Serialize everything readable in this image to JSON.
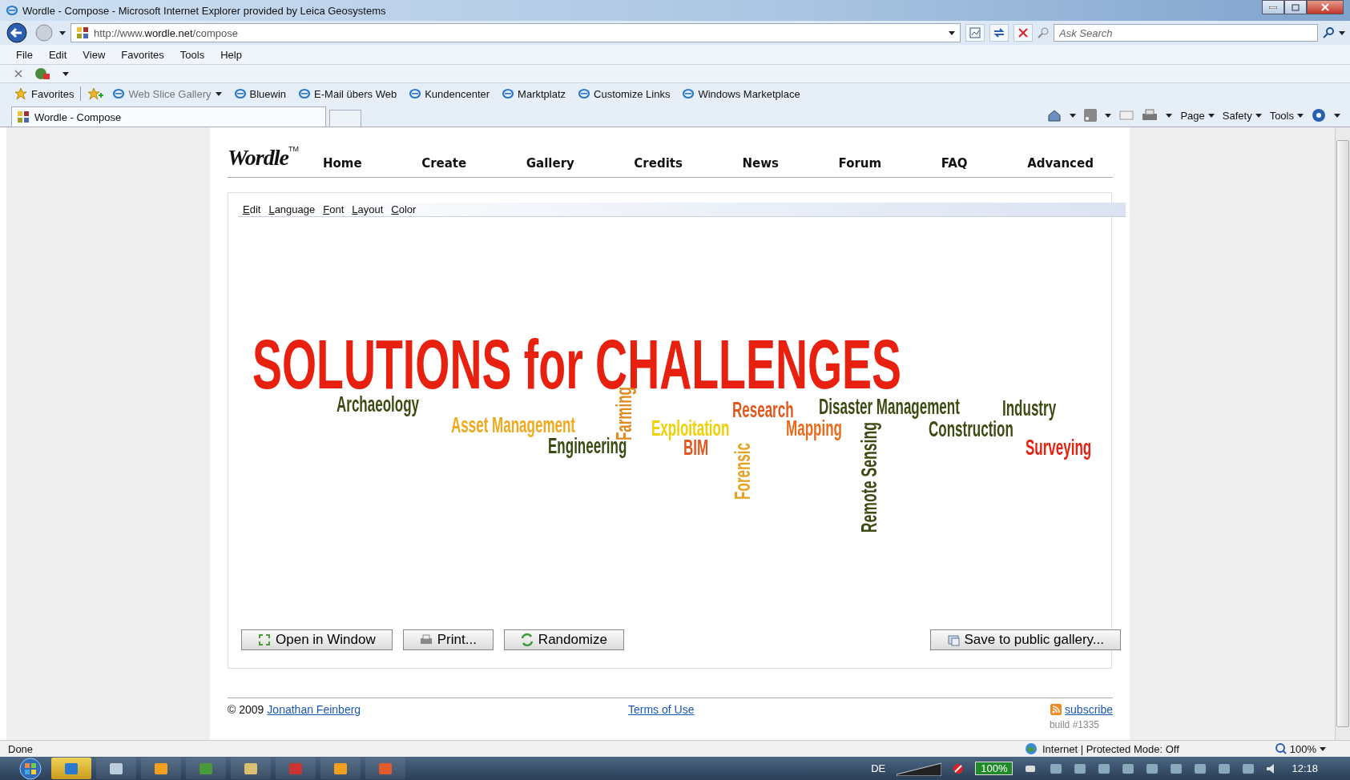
{
  "window": {
    "title": "Wordle - Compose - Microsoft Internet Explorer provided by Leica Geosystems"
  },
  "address_bar": {
    "url": "http://www.**wordle.net**/compose"
  },
  "search": {
    "placeholder": "Ask Search"
  },
  "menu_bar": [
    "File",
    "Edit",
    "View",
    "Favorites",
    "Tools",
    "Help"
  ],
  "favorites_bar": {
    "label": "Favorites",
    "links": [
      {
        "label": "Web Slice Gallery",
        "dropdown": true
      },
      {
        "label": "Bluewin",
        "dropdown": false
      },
      {
        "label": "E-Mail übers Web",
        "dropdown": false
      },
      {
        "label": "Kundencenter",
        "dropdown": false
      },
      {
        "label": "Marktplatz",
        "dropdown": false
      },
      {
        "label": "Customize Links",
        "dropdown": false
      },
      {
        "label": "Windows Marketplace",
        "dropdown": false
      }
    ]
  },
  "tabs": [
    {
      "label": "Wordle - Compose",
      "selected": true
    }
  ],
  "command_bar": [
    "Page",
    "Safety",
    "Tools"
  ],
  "site": {
    "logo": "Wordle",
    "trademark": "TM",
    "nav": [
      "Home",
      "Create",
      "Gallery",
      "Credits",
      "News",
      "Forum",
      "FAQ",
      "Advanced"
    ]
  },
  "editor_menu": [
    "Edit",
    "Language",
    "Font",
    "Layout",
    "Color"
  ],
  "cloud": [
    {
      "text": "SOLUTIONS for CHALLENGES",
      "color": "#e8200f",
      "kind": "horizontal"
    },
    {
      "text": "Archaeology",
      "color": "#3d4a12",
      "kind": "horizontal"
    },
    {
      "text": "Asset Management",
      "color": "#f2a81d",
      "kind": "horizontal"
    },
    {
      "text": "Farming",
      "color": "#e08a1e",
      "kind": "vertical"
    },
    {
      "text": "Engineering",
      "color": "#3a4a10",
      "kind": "horizontal"
    },
    {
      "text": "Exploitation",
      "color": "#f0d000",
      "kind": "horizontal"
    },
    {
      "text": "BIM",
      "color": "#e2571e",
      "kind": "horizontal"
    },
    {
      "text": "Forensic",
      "color": "#e8a020",
      "kind": "vertical"
    },
    {
      "text": "Research",
      "color": "#e2571e",
      "kind": "horizontal"
    },
    {
      "text": "Mapping",
      "color": "#e86a1a",
      "kind": "horizontal"
    },
    {
      "text": "Disaster Management",
      "color": "#3d4a12",
      "kind": "horizontal"
    },
    {
      "text": "Remote Sensing",
      "color": "#3d4a12",
      "kind": "vertical"
    },
    {
      "text": "Industry",
      "color": "#3d4a12",
      "kind": "horizontal"
    },
    {
      "text": "Construction",
      "color": "#3d4a12",
      "kind": "horizontal"
    },
    {
      "text": "Surveying",
      "color": "#e8200f",
      "kind": "horizontal"
    }
  ],
  "buttons": [
    "Open in Window",
    "Print...",
    "Randomize",
    "Save to public gallery..."
  ],
  "footer": {
    "copyright": "© 2009",
    "author_link": "Jonathan Feinberg",
    "terms_link": "Terms of Use",
    "subscribe_link": "subscribe",
    "build": "build #1335"
  },
  "status_bar": {
    "text": "Done",
    "zone": "Internet | Protected Mode: Off",
    "zoom": "100%"
  },
  "taskbar": {
    "language": "DE",
    "battery": "100%",
    "clock": "12:18"
  }
}
